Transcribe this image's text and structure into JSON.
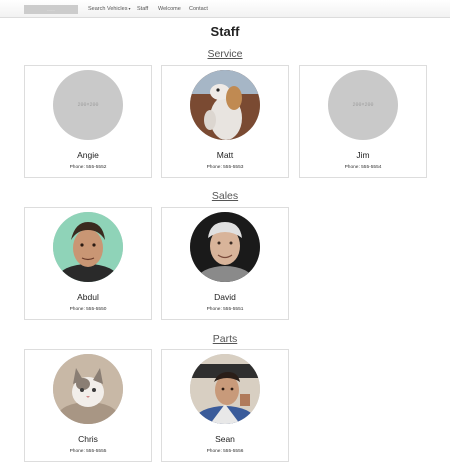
{
  "navbar": {
    "brand": "------",
    "items": [
      {
        "label": "Search Vehicles",
        "has_caret": true
      },
      {
        "label": "Staff"
      },
      {
        "label": "Welcome"
      },
      {
        "label": "Contact"
      }
    ]
  },
  "page": {
    "title": "Staff"
  },
  "sections": [
    {
      "title": "Service",
      "staff": [
        {
          "name": "Angie",
          "phone": "Phone: 555-5552",
          "placeholder": "200×200"
        },
        {
          "name": "Matt",
          "phone": "Phone: 555-5553"
        },
        {
          "name": "Jim",
          "phone": "Phone: 555-5554",
          "placeholder": "200×200"
        }
      ]
    },
    {
      "title": "Sales",
      "staff": [
        {
          "name": "Abdul",
          "phone": "Phone: 555-5550"
        },
        {
          "name": "David",
          "phone": "Phone: 555-5551"
        }
      ]
    },
    {
      "title": "Parts",
      "staff": [
        {
          "name": "Chris",
          "phone": "Phone: 555-5555"
        },
        {
          "name": "Sean",
          "phone": "Phone: 555-5556"
        }
      ]
    }
  ],
  "colors": {
    "placeholder_bg": "#c9c9c9",
    "card_border": "#dddddd",
    "section_title": "#555555"
  }
}
